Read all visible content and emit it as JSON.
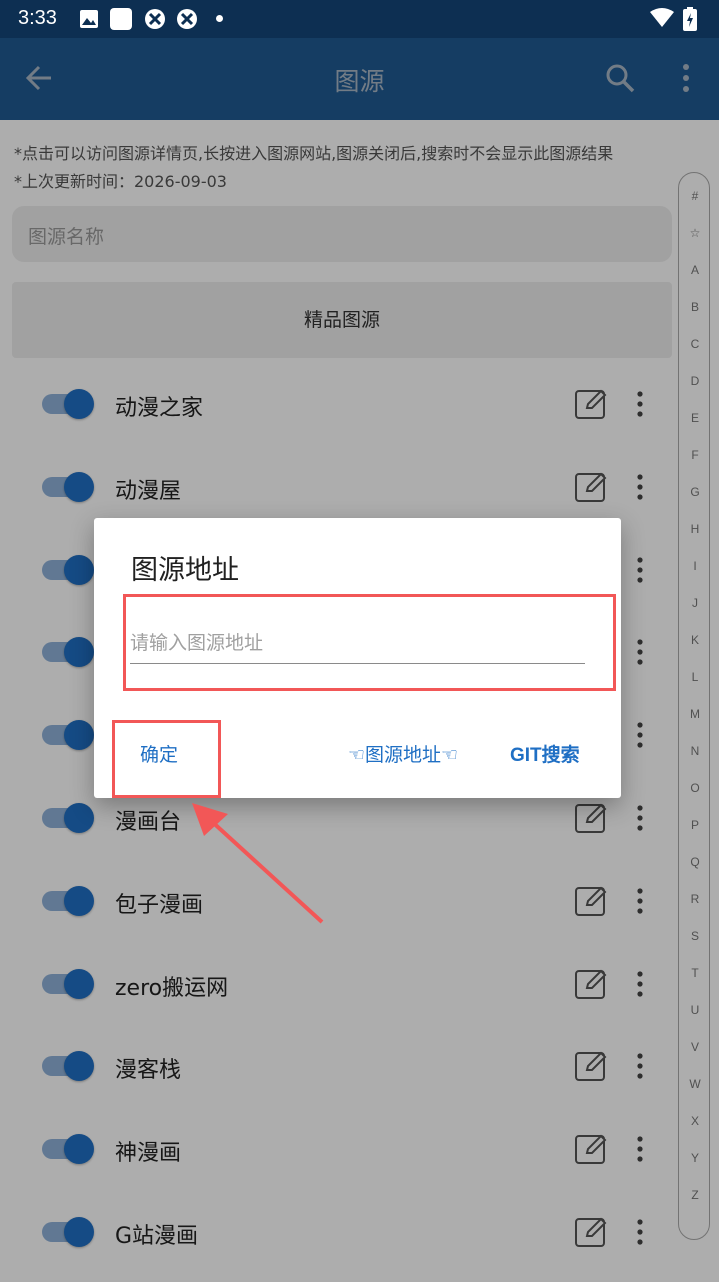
{
  "status_bar": {
    "time": "3:33"
  },
  "app_bar": {
    "title": "图源"
  },
  "notes": [
    "*点击可以访问图源详情页,长按进入图源网站,图源关闭后,搜索时不会显示此图源结果",
    "*上次更新时间：2026-09-03"
  ],
  "search": {
    "placeholder": "图源名称"
  },
  "premium": {
    "label": "精品图源"
  },
  "sources": [
    {
      "name": "动漫之家",
      "enabled": true
    },
    {
      "name": "动漫屋",
      "enabled": true
    },
    {
      "name": "",
      "enabled": true
    },
    {
      "name": "",
      "enabled": true
    },
    {
      "name": "",
      "enabled": true
    },
    {
      "name": "漫画台",
      "enabled": true
    },
    {
      "name": "包子漫画",
      "enabled": true
    },
    {
      "name": "zero搬运网",
      "enabled": true
    },
    {
      "name": "漫客栈",
      "enabled": true
    },
    {
      "name": "神漫画",
      "enabled": true
    },
    {
      "name": "G站漫画",
      "enabled": true
    }
  ],
  "alpha_index": [
    "#",
    "☆",
    "A",
    "B",
    "C",
    "D",
    "E",
    "F",
    "G",
    "H",
    "I",
    "J",
    "K",
    "L",
    "M",
    "N",
    "O",
    "P",
    "Q",
    "R",
    "S",
    "T",
    "U",
    "V",
    "W",
    "X",
    "Y",
    "Z"
  ],
  "dialog": {
    "title": "图源地址",
    "input_placeholder": "请输入图源地址",
    "input_value": "",
    "confirm_label": "确定",
    "addr_label": "☜图源地址☜",
    "git_label": "GIT搜索"
  },
  "colors": {
    "primary": "#1f5a92",
    "status_bar": "#0d2f52",
    "accent": "#1f6fc4",
    "highlight": "#f25757"
  }
}
